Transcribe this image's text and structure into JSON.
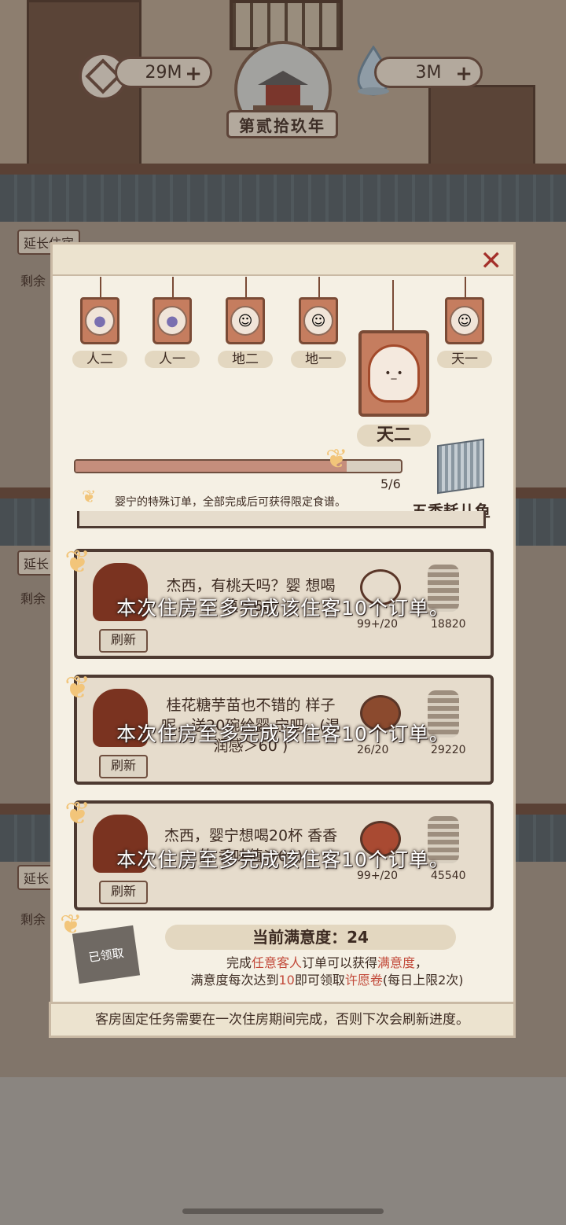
{
  "header": {
    "coins": "29M",
    "spirit": "3M",
    "year": "第贰拾玖年",
    "plus": "+"
  },
  "side": {
    "tag1": "延长住宿",
    "remain": "剩余",
    "tag2": "延长",
    "tag3": "延长"
  },
  "modal": {
    "close": "✕",
    "tiers": [
      {
        "label": "人二",
        "face": "●"
      },
      {
        "label": "人一",
        "face": "●"
      },
      {
        "label": "地二",
        "face": "☺"
      },
      {
        "label": "地一",
        "face": "☺"
      },
      {
        "label": "天一",
        "face": "☺"
      }
    ],
    "selected_tier": {
      "label": "天二",
      "face": "•_•"
    },
    "progress": {
      "value": 5,
      "max": 6,
      "text": "5/6"
    },
    "hint": "婴宁的特殊订单，全部完成后可获得限定食谱。",
    "reward": {
      "name": "五香耗儿鱼"
    },
    "orders": [
      {
        "text": "杰西，有桃夭吗？婴宁想喝20杯(香味值＞60)",
        "text_visible": "杰西，有桃夭吗？婴 想喝 值＞60)",
        "dish_count": "99+/20",
        "coins": "18820",
        "refresh": "刷新",
        "limit_note": "本次住房至多完成该住客10个订单。"
      },
      {
        "text": "桂花糖芋苗也不错的样子呢，送20碗给婴宁吧。(温润感＞60)",
        "text_visible": "桂花糖芋苗也不错的 样子呢，送20碗给婴 宁吧。(温润感＞60 )",
        "dish_count": "26/20",
        "coins": "29220",
        "refresh": "刷新",
        "limit_note": "本次住房至多完成该住客10个订单。"
      },
      {
        "text": "杰西，婴宁想喝20杯香香的茶(香味值＞60)",
        "text_visible": "杰西，婴宁想喝20杯 香香的 香味值＞60)",
        "dish_count": "99+/20",
        "coins": "45540",
        "refresh": "刷新",
        "limit_note": "本次住房至多完成该住客10个订单。"
      }
    ],
    "claimed": "已领取",
    "satisfaction": "当前满意度：24",
    "sat_desc_1a": "完成",
    "sat_desc_1b": "任意客人",
    "sat_desc_1c": "订单可以获得",
    "sat_desc_1d": "满意度",
    "sat_desc_1e": "，",
    "sat_desc_2a": "满意度每次达到",
    "sat_desc_2b": "10",
    "sat_desc_2c": "即可领取",
    "sat_desc_2d": "许愿卷",
    "sat_desc_2e": "(每日上限2次)",
    "footer": "客房固定任务需要在一次住房期间完成，否则下次会刷新进度。"
  },
  "colors": {
    "accent_red": "#c24a3a",
    "panel": "#f5f0e4",
    "wood": "#6f4f3f"
  }
}
